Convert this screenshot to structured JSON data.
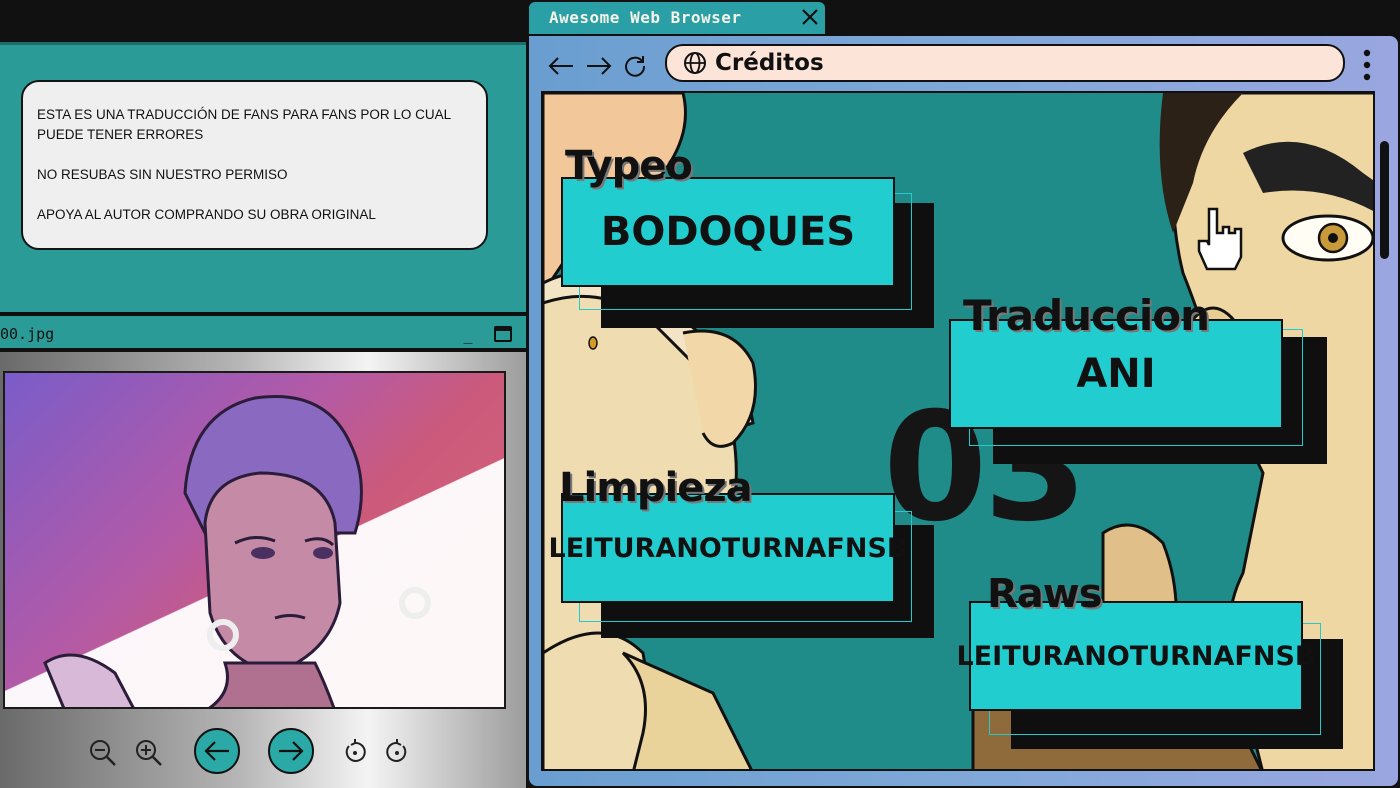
{
  "notice": {
    "line1": "ESTA ES UNA TRADUCCIÓN DE FANS PARA FANS POR LO CUAL PUEDE TENER ERRORES",
    "line2": "NO RESUBAS SIN NUESTRO PERMISO",
    "line3": "APOYA AL AUTOR COMPRANDO SU OBRA ORIGINAL"
  },
  "viewer": {
    "filename": "00.jpg",
    "minimize_label": "_",
    "toolbar": {
      "zoom_out_icon": "zoom-out-icon",
      "zoom_in_icon": "zoom-in-icon",
      "prev_icon": "arrow-left-icon",
      "next_icon": "arrow-right-icon",
      "rotate_left_icon": "rotate-left-icon",
      "rotate_right_icon": "rotate-right-icon"
    }
  },
  "browser": {
    "tab_title": "Awesome Web Browser",
    "address": "Créditos",
    "colors": {
      "chrome": "#7fa8d8",
      "tab": "#2aa0a6",
      "address_bg": "#fde4d8"
    }
  },
  "credits": {
    "big_number": "03",
    "typeo": {
      "label": "Typeo",
      "value": "BODOQUES"
    },
    "traduccion": {
      "label": "Traduccion",
      "value": "ANI"
    },
    "limpieza": {
      "label": "Limpieza",
      "value": "LEITURANOTURNAFNSB"
    },
    "raws": {
      "label": "Raws",
      "value": "LEITURANOTURNAFNSB"
    },
    "colors": {
      "card": "#22cdd0",
      "background": "#1f8c8a"
    }
  }
}
